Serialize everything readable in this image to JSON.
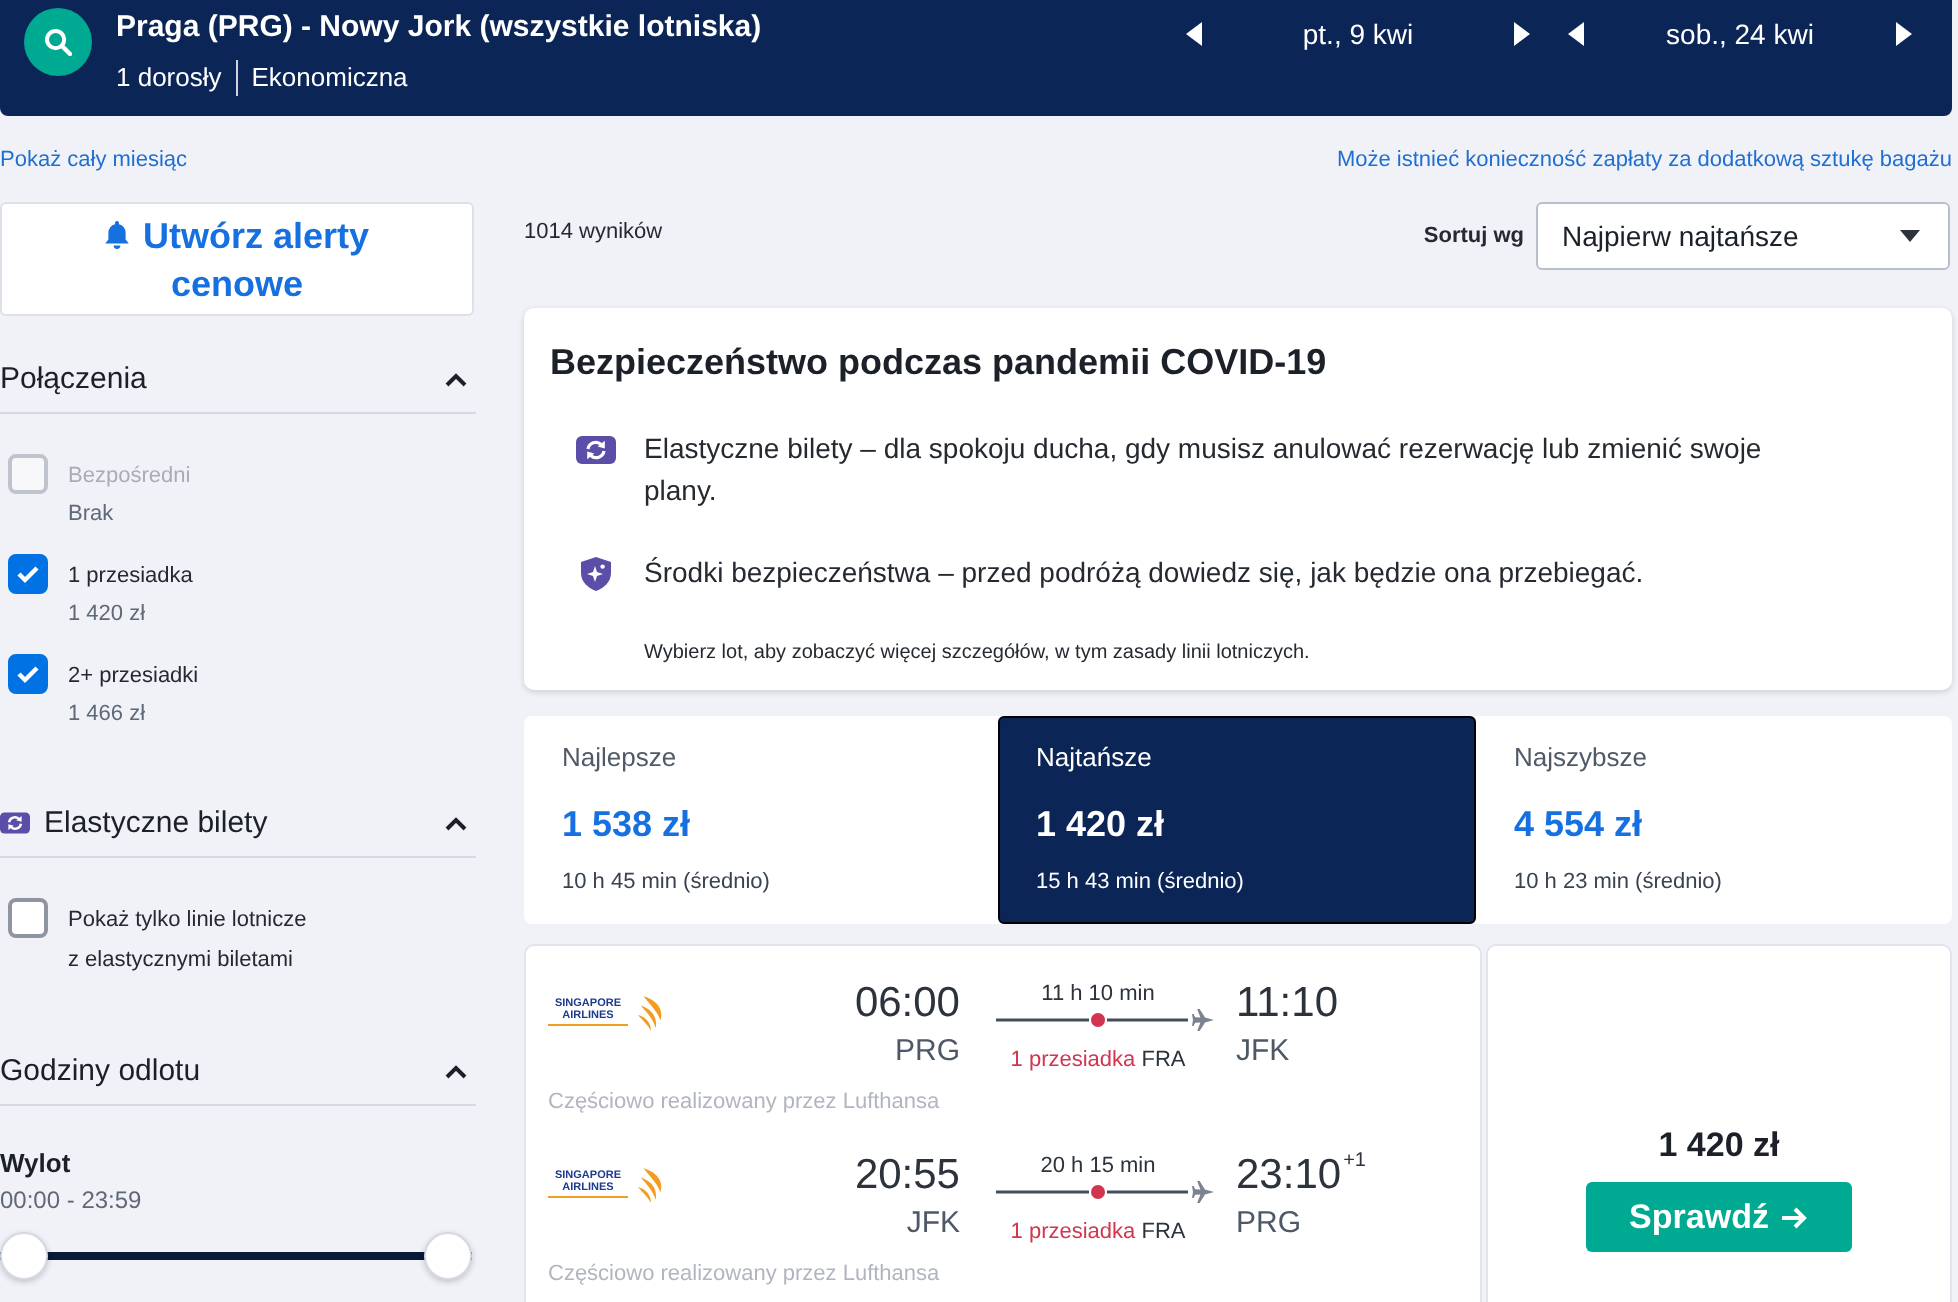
{
  "header": {
    "route": "Praga (PRG) - Nowy Jork (wszystkie lotniska)",
    "passengers": "1 dorosły",
    "cabin": "Ekonomiczna",
    "dates": [
      {
        "label": "pt., 9 kwi"
      },
      {
        "label": "sob., 24 kwi"
      }
    ]
  },
  "links": {
    "month": "Pokaż cały miesiąc",
    "baggage": "Może istnieć konieczność zapłaty za dodatkową sztukę bagażu"
  },
  "sidebar": {
    "alert_button": "Utwórz alerty cenowe",
    "sections": [
      {
        "kind": "stops",
        "title": "Połączenia",
        "expanded": true,
        "options": [
          {
            "label": "Bezpośredni",
            "price": "Brak",
            "checked": false,
            "disabled": true
          },
          {
            "label": "1 przesiadka",
            "price": "1 420 zł",
            "checked": true,
            "disabled": false
          },
          {
            "label": "2+ przesiadki",
            "price": "1 466 zł",
            "checked": true,
            "disabled": false
          }
        ]
      },
      {
        "kind": "flexible",
        "title": "Elastyczne bilety",
        "expanded": true,
        "options": [
          {
            "label": "Pokaż tylko linie lotnicze z elastycznymi biletami",
            "checked": false,
            "disabled": false
          }
        ]
      },
      {
        "kind": "times",
        "title": "Godziny odlotu",
        "expanded": true,
        "sliders": [
          {
            "label": "Wylot",
            "range": "00:00 - 23:59",
            "level": 1
          }
        ]
      }
    ]
  },
  "results_count": "1014 wyników",
  "sort": {
    "label": "Sortuj wg",
    "value": "Najpierw najtańsze"
  },
  "notice": {
    "title": "Bezpieczeństwo podczas pandemii COVID-19",
    "items": [
      {
        "kind": "flexible",
        "text": "Elastyczne bilety – dla spokoju ducha, gdy musisz anulować rezerwację lub zmienić swoje plany."
      },
      {
        "kind": "safety",
        "text": "Środki bezpieczeństwa – przed podróżą dowiedz się, jak będzie ona przebiegać."
      }
    ],
    "footnote": "Wybierz lot, aby zobaczyć więcej szczegółów, w tym zasady linii lotniczych."
  },
  "tabs": [
    {
      "label": "Najlepsze",
      "price": "1 538 zł",
      "duration": "10 h 45 min (średnio)",
      "selected": false
    },
    {
      "label": "Najtańsze",
      "price": "1 420 zł",
      "duration": "15 h 43 min (średnio)",
      "selected": true
    },
    {
      "label": "Najszybsze",
      "price": "4 554 zł",
      "duration": "10 h 23 min (średnio)",
      "selected": false
    }
  ],
  "results": [
    {
      "legs": [
        {
          "airline_logo": "SINGAPORE AIRLINES",
          "departure_time": "06:00",
          "departure_airport": "PRG",
          "duration": "11 h 10 min",
          "stops": "1 przesiadka",
          "stop_airport": "FRA",
          "arrival_time": "11:10",
          "arrival_airport": "JFK",
          "operator_note": "Częściowo realizowany przez Lufthansa"
        },
        {
          "airline_logo": "SINGAPORE AIRLINES",
          "departure_time": "20:55",
          "departure_airport": "JFK",
          "duration": "20 h 15 min",
          "stops": "1 przesiadka",
          "stop_airport": "FRA",
          "arrival_time": "23:10",
          "day_offset": "+1",
          "arrival_airport": "PRG",
          "operator_note": "Częściowo realizowany przez Lufthansa"
        }
      ],
      "price": "1 420 zł",
      "button": "Sprawdź"
    }
  ]
}
